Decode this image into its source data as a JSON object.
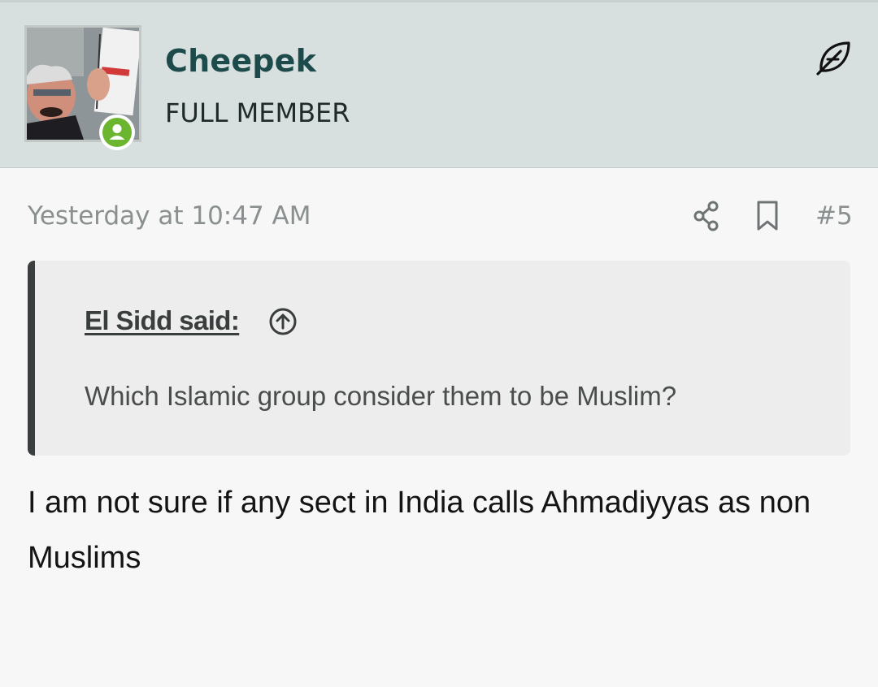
{
  "user": {
    "username": "Cheepek",
    "title": "FULL MEMBER",
    "online_status": "online",
    "avatar_icon": "user-avatar-photo",
    "feather_icon": "feather-icon"
  },
  "post": {
    "timestamp": "Yesterday at 10:47 AM",
    "number": "#5",
    "share_icon": "share-icon",
    "bookmark_icon": "bookmark-icon"
  },
  "quote": {
    "author_label": "El Sidd said:",
    "jump_icon": "arrow-up-circle-icon",
    "text": "Which Islamic group consider them to be Muslim?"
  },
  "body": {
    "text": "I am not sure if any sect in India calls Ahmadiyyas as non Muslims"
  },
  "colors": {
    "header_bg": "#d8e0df",
    "username": "#1d4b4b",
    "online_green": "#6bb52f",
    "quote_bg": "#ededed",
    "quote_bar": "#3b3e3e",
    "muted_text": "#8a8f8f"
  }
}
